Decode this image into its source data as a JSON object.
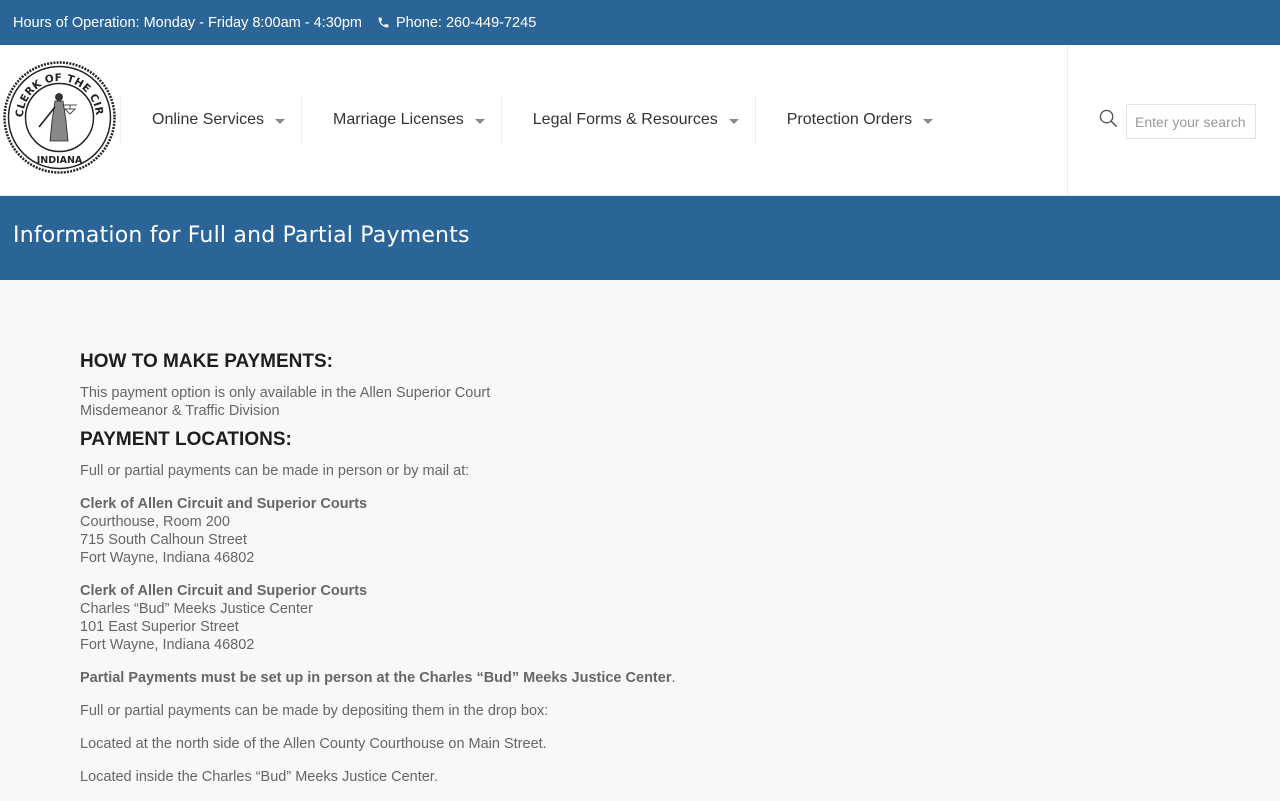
{
  "topbar": {
    "hours": "Hours of Operation: Monday - Friday 8:00am - 4:30pm",
    "phone": "Phone: 260-449-7245"
  },
  "logo": {
    "ring_text": "CLERK OF THE CIRCUIT COURT",
    "bottom_text": "INDIANA"
  },
  "nav": {
    "items": [
      {
        "label": "Online Services"
      },
      {
        "label": "Marriage Licenses"
      },
      {
        "label": "Legal Forms & Resources"
      },
      {
        "label": "Protection Orders"
      }
    ]
  },
  "search": {
    "placeholder": "Enter your search"
  },
  "page": {
    "title": "Information for Full and Partial Payments"
  },
  "content": {
    "heading_payments": "HOW TO MAKE PAYMENTS:",
    "payments_line1": "This payment option is only available in the Allen Superior Court",
    "payments_line2": "Misdemeanor & Traffic Division",
    "heading_locations": "PAYMENT LOCATIONS:",
    "locations_intro": "Full or partial payments can be made in person or by mail at:",
    "address1": {
      "name": "Clerk of Allen Circuit and Superior Courts",
      "line1": "Courthouse, Room 200",
      "line2": "715 South Calhoun Street",
      "line3": "Fort Wayne, Indiana 46802"
    },
    "address2": {
      "name": "Clerk of Allen Circuit and Superior Courts",
      "line1": "Charles “Bud” Meeks Justice Center",
      "line2": "101 East Superior Street",
      "line3": "Fort Wayne, Indiana 46802"
    },
    "partial_note": "Partial Payments must be set up in person at the Charles “Bud” Meeks Justice Center",
    "partial_note_end": ".",
    "dropbox_intro": "Full or partial payments can be made by depositing them in the drop box:",
    "dropbox_loc1": "Located at the north side of the Allen County Courthouse on Main Street.",
    "dropbox_loc2": "Located inside the Charles “Bud” Meeks Justice Center."
  },
  "colors": {
    "brand_blue": "#2b6598",
    "heading": "#1e1e1e",
    "body_text": "#666666"
  }
}
